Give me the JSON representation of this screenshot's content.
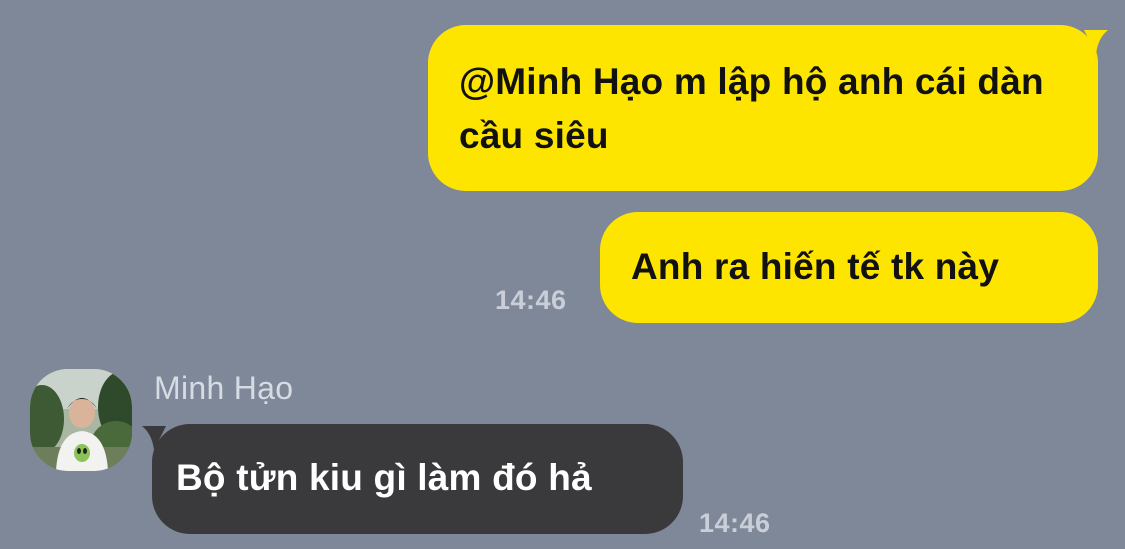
{
  "theme": {
    "background": "#7f8899",
    "outgoing_bubble": "#fee500",
    "incoming_bubble": "#3a3a3c"
  },
  "messages": [
    {
      "direction": "outgoing",
      "text": "@Minh Hạo m lập hộ anh cái dàn cầu siêu"
    },
    {
      "direction": "outgoing",
      "text": "Anh ra hiến tế tk này",
      "time": "14:46"
    },
    {
      "direction": "incoming",
      "sender": "Minh Hạo",
      "avatar": "user-avatar",
      "text": "Bộ tửn kiu gì làm đó hả",
      "time": "14:46"
    }
  ]
}
